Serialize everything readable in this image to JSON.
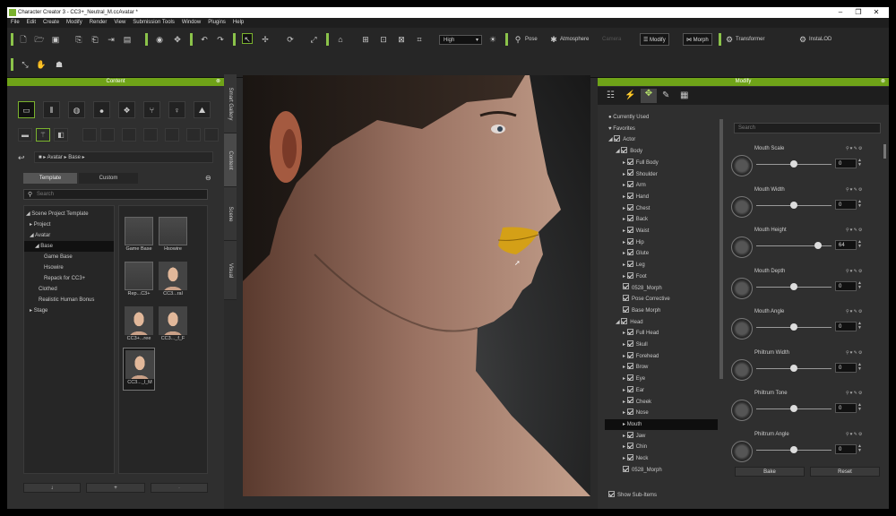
{
  "window": {
    "title": "Character Creator 3 - CC3+_Neutral_M.ccAvatar *",
    "min": "–",
    "max": "❐",
    "close": "✕"
  },
  "menu": [
    "File",
    "Edit",
    "Create",
    "Modify",
    "Render",
    "View",
    "Submission Tools",
    "Window",
    "Plugins",
    "Help"
  ],
  "toolbar": {
    "quality": "High",
    "pose": "Pose",
    "atmosphere": "Atmosphere",
    "camera": "Camera",
    "modify": "Modify",
    "morph": "Morph",
    "transformer": "Transformer",
    "instaloD": "InstaLOD"
  },
  "content": {
    "header": "Content",
    "path": [
      "Avatar",
      "Base"
    ],
    "tabs": [
      "Template",
      "Custom"
    ],
    "search_placeholder": "Search",
    "tree": [
      "Scene Project Template",
      "Project",
      "Avatar",
      "Base",
      "Game Base",
      "Hsowire",
      "Repack for CC3+",
      "Clothed",
      "Realistic Human Bonus",
      "Stage"
    ],
    "thumbs": [
      "Game Base",
      "Hsowire",
      "Rep...C3+",
      "CC3...ral",
      "CC3+...ree",
      "CC3..._f_F",
      "CC3..._l_M"
    ],
    "bottom": {
      "down": "↓",
      "add": "+",
      "sub": "-"
    }
  },
  "sidetabs": [
    "Smart Gallery",
    "Content",
    "Scene",
    "Visual"
  ],
  "modify": {
    "header": "Modify",
    "search_placeholder": "Search",
    "tree": [
      {
        "label": "Currently Used",
        "indent": 0,
        "arrow": "",
        "cb": false
      },
      {
        "label": "Favorites",
        "indent": 0,
        "arrow": "",
        "cb": false
      },
      {
        "label": "Actor",
        "indent": 0,
        "arrow": "◢",
        "cb": true
      },
      {
        "label": "Body",
        "indent": 1,
        "arrow": "◢",
        "cb": true
      },
      {
        "label": "Full Body",
        "indent": 2,
        "arrow": "▸",
        "cb": true
      },
      {
        "label": "Shoulder",
        "indent": 2,
        "arrow": "▸",
        "cb": true
      },
      {
        "label": "Arm",
        "indent": 2,
        "arrow": "▸",
        "cb": true
      },
      {
        "label": "Hand",
        "indent": 2,
        "arrow": "▸",
        "cb": true
      },
      {
        "label": "Chest",
        "indent": 2,
        "arrow": "▸",
        "cb": true
      },
      {
        "label": "Back",
        "indent": 2,
        "arrow": "▸",
        "cb": true
      },
      {
        "label": "Waist",
        "indent": 2,
        "arrow": "▸",
        "cb": true
      },
      {
        "label": "Hip",
        "indent": 2,
        "arrow": "▸",
        "cb": true
      },
      {
        "label": "Glute",
        "indent": 2,
        "arrow": "▸",
        "cb": true
      },
      {
        "label": "Leg",
        "indent": 2,
        "arrow": "▸",
        "cb": true
      },
      {
        "label": "Foot",
        "indent": 2,
        "arrow": "▸",
        "cb": true
      },
      {
        "label": "0528_Morph",
        "indent": 2,
        "arrow": "",
        "cb": true
      },
      {
        "label": "Pose Corrective",
        "indent": 2,
        "arrow": "",
        "cb": true
      },
      {
        "label": "Base Morph",
        "indent": 2,
        "arrow": "",
        "cb": true
      },
      {
        "label": "Head",
        "indent": 1,
        "arrow": "◢",
        "cb": true
      },
      {
        "label": "Full Head",
        "indent": 2,
        "arrow": "▸",
        "cb": true
      },
      {
        "label": "Skull",
        "indent": 2,
        "arrow": "▸",
        "cb": true
      },
      {
        "label": "Forehead",
        "indent": 2,
        "arrow": "▸",
        "cb": true
      },
      {
        "label": "Brow",
        "indent": 2,
        "arrow": "▸",
        "cb": true
      },
      {
        "label": "Eye",
        "indent": 2,
        "arrow": "▸",
        "cb": true
      },
      {
        "label": "Ear",
        "indent": 2,
        "arrow": "▸",
        "cb": true
      },
      {
        "label": "Cheek",
        "indent": 2,
        "arrow": "▸",
        "cb": true
      },
      {
        "label": "Nose",
        "indent": 2,
        "arrow": "▸",
        "cb": true
      },
      {
        "label": "Mouth",
        "indent": 2,
        "arrow": "▸",
        "cb": false,
        "hl": true
      },
      {
        "label": "Jaw",
        "indent": 2,
        "arrow": "▸",
        "cb": true
      },
      {
        "label": "Chin",
        "indent": 2,
        "arrow": "▸",
        "cb": true
      },
      {
        "label": "Neck",
        "indent": 2,
        "arrow": "▸",
        "cb": true
      },
      {
        "label": "0528_Morph",
        "indent": 2,
        "arrow": "",
        "cb": true
      }
    ],
    "show_sub": "Show Sub-Items",
    "sliders": [
      {
        "name": "Mouth Scale",
        "value": "0",
        "pos": 0.5
      },
      {
        "name": "Mouth Width",
        "value": "0",
        "pos": 0.5
      },
      {
        "name": "Mouth Height",
        "value": "64",
        "pos": 0.82
      },
      {
        "name": "Mouth Depth",
        "value": "0",
        "pos": 0.5
      },
      {
        "name": "Mouth Angle",
        "value": "0",
        "pos": 0.5
      },
      {
        "name": "Philtrum Width",
        "value": "0",
        "pos": 0.5
      },
      {
        "name": "Philtrum Tone",
        "value": "0",
        "pos": 0.5
      },
      {
        "name": "Philtrum Angle",
        "value": "0",
        "pos": 0.5
      }
    ],
    "bake": "Bake",
    "reset": "Reset"
  },
  "colors": {
    "accent": "#7ab22e",
    "lips": "#d4a017"
  }
}
